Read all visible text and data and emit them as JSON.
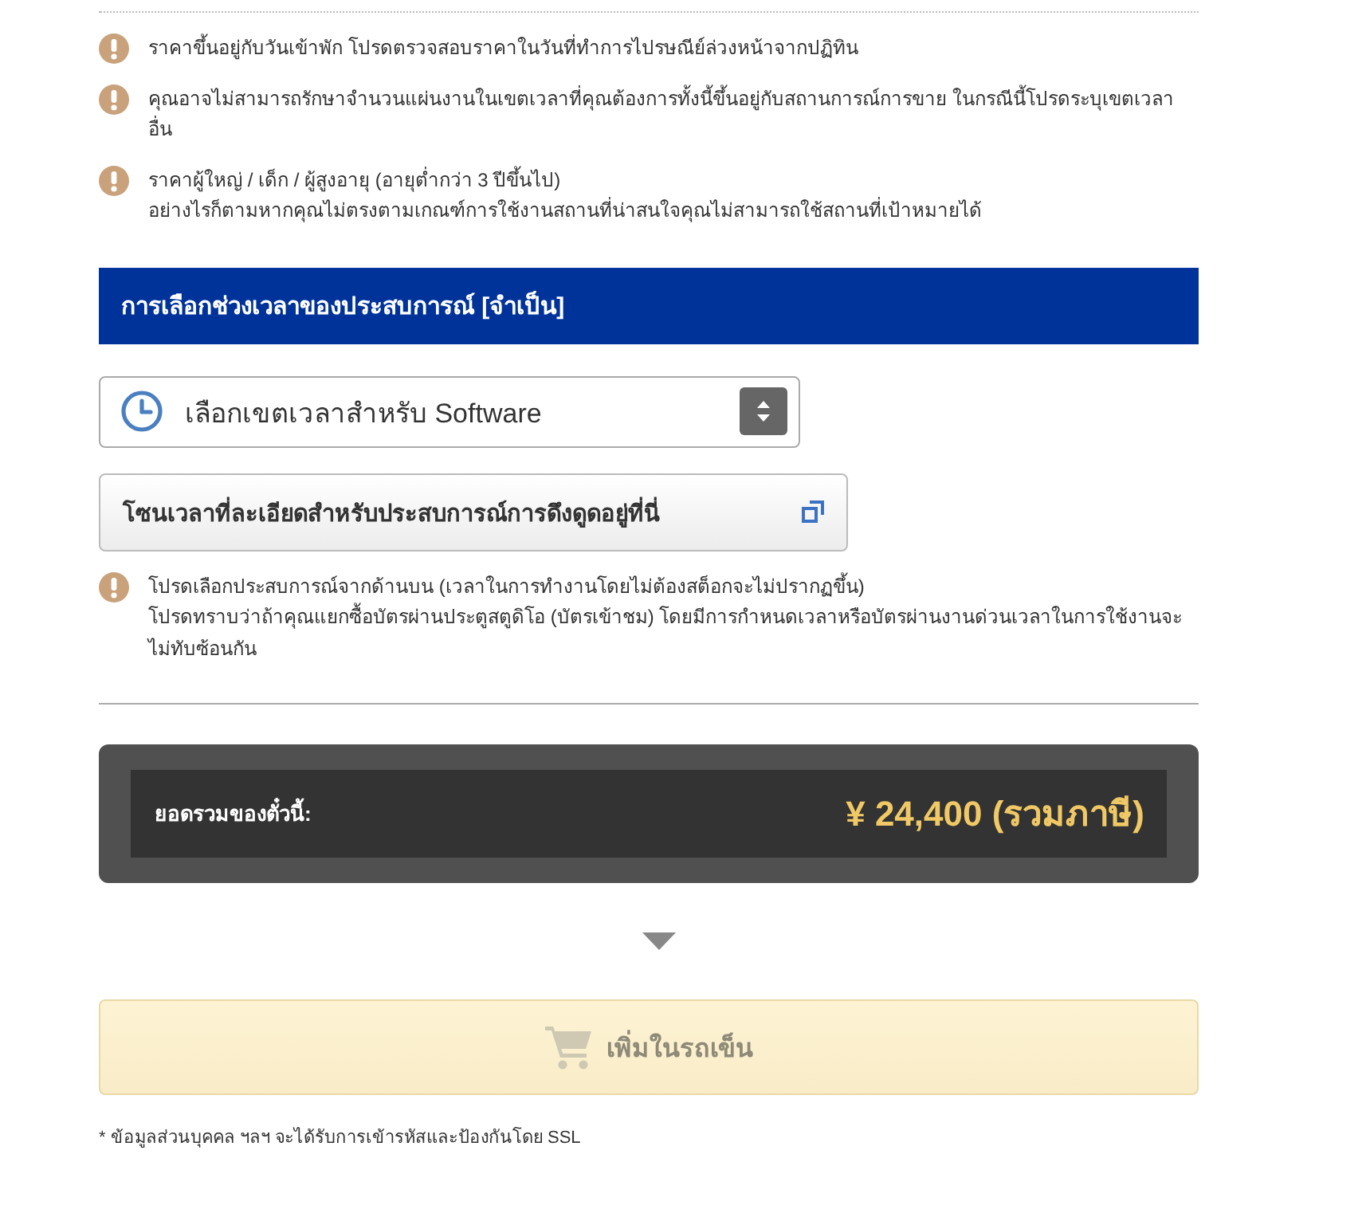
{
  "notices": [
    {
      "lines": [
        "ราคาขึ้นอยู่กับวันเข้าพัก โปรดตรวจสอบราคาในวันที่ทำการไปรษณีย์ล่วงหน้าจากปฏิทิน"
      ]
    },
    {
      "lines": [
        "คุณอาจไม่สามารถรักษาจำนวนแผ่นงานในเขตเวลาที่คุณต้องการทั้งนี้ขึ้นอยู่กับสถานการณ์การขาย ในกรณีนี้โปรดระบุเขตเวลาอื่น"
      ]
    },
    {
      "lines": [
        "ราคาผู้ใหญ่ / เด็ก / ผู้สูงอายุ (อายุต่ำกว่า 3 ปีขึ้นไป)",
        "อย่างไรก็ตามหากคุณไม่ตรงตามเกณฑ์การใช้งานสถานที่น่าสนใจคุณไม่สามารถใช้สถานที่เป้าหมายได้"
      ]
    }
  ],
  "section": {
    "title": "การเลือกช่วงเวลาของประสบการณ์ [จำเป็น]"
  },
  "timeslot_select": {
    "value": "เลือกเขตเวลาสำหรับ Software"
  },
  "details_link": {
    "label": "โซนเวลาที่ละเอียดสำหรับประสบการณ์การดึงดูดอยู่ที่นี่"
  },
  "section_notices": [
    {
      "lines": [
        "โปรดเลือกประสบการณ์จากด้านบน (เวลาในการทำงานโดยไม่ต้องสต็อกจะไม่ปรากฏขึ้น)",
        "โปรดทราบว่าถ้าคุณแยกซื้อบัตรผ่านประตูสตูดิโอ (บัตรเข้าชม) โดยมีการกำหนดเวลาหรือบัตรผ่านงานด่วนเวลาในการใช้งานจะไม่ทับซ้อนกัน"
      ]
    }
  ],
  "total": {
    "label": "ยอดรวมของตั๋วนี้:",
    "amount": "¥ 24,400 (รวมภาษี)"
  },
  "cart_button": {
    "label": "เพิ่มในรถเข็น",
    "disabled": true
  },
  "footnote": "* ข้อมูลส่วนบุคคล ฯลฯ จะได้รับการเข้ารหัสและป้องกันโดย SSL"
}
